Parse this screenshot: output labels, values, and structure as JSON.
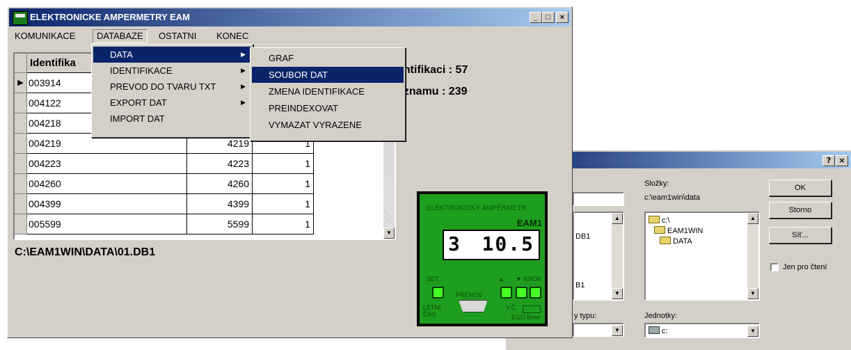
{
  "window": {
    "title": "ELEKTRONICKE AMPERMETRY EAM",
    "controls": [
      "_",
      "□",
      "×"
    ]
  },
  "menubar": [
    "KOMUNIKACE",
    "DATABAZE",
    "OSTATNI",
    "KONEC"
  ],
  "databaze_menu": [
    {
      "label": "DATA",
      "submenu": true
    },
    {
      "label": "IDENTIFIKACE",
      "submenu": true
    },
    {
      "label": "PREVOD DO TVARU TXT",
      "submenu": true
    },
    {
      "label": "EXPORT DAT",
      "submenu": true
    },
    {
      "label": "IMPORT DAT",
      "submenu": false
    }
  ],
  "data_submenu": [
    "GRAF",
    "SOUBOR DAT",
    "ZMENA IDENTIFIKACE",
    "PREINDEXOVAT",
    "VYMAZAT VYRAZENE"
  ],
  "grid": {
    "header": "Identifika",
    "rows": [
      [
        "003914",
        "",
        ""
      ],
      [
        "004122",
        "",
        ""
      ],
      [
        "004218",
        "",
        ""
      ],
      [
        "004219",
        "4219",
        "1"
      ],
      [
        "004223",
        "4223",
        "1"
      ],
      [
        "004260",
        "4260",
        "1"
      ],
      [
        "004399",
        "4399",
        "1"
      ],
      [
        "005599",
        "5599",
        "1"
      ]
    ]
  },
  "stats": {
    "line1": "entifikaci : 57",
    "line2": "aznamu   : 239"
  },
  "path": "C:\\EAM1WIN\\DATA\\01.DB1",
  "device": {
    "title": "ELEKTRONICKÝ AMPÉRMETR",
    "model": "EAM1",
    "display_left": "3",
    "display_right": "10.5",
    "set": "SET",
    "up": "▲",
    "down": "▼",
    "krok": "KROK",
    "prenos": "PŘENOS",
    "letni": "LETNÍ",
    "cas": "ČAS",
    "vc": "V.Č.",
    "maker": "EGÚ Brno"
  },
  "dialog": {
    "controls": [
      "?",
      "×"
    ],
    "folders_label": "Složky:",
    "folders_path": "c:\\eam1win\\data",
    "folders": [
      "c:\\",
      "EAM1WIN",
      "DATA"
    ],
    "file_list_items": [
      "DB1",
      "B1"
    ],
    "type_label": "y typu:",
    "drives_label": "Jednotky:",
    "drive_value": "c:",
    "ok": "OK",
    "cancel": "Storno",
    "network": "Síť...",
    "readonly": "Jen pro čtení"
  }
}
